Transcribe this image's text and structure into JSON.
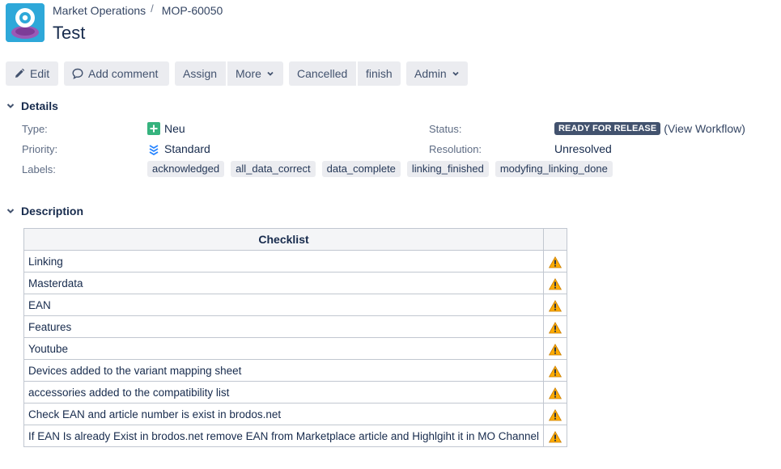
{
  "breadcrumb": {
    "project": "Market Operations",
    "issue_key": "MOP-60050",
    "separator": "/"
  },
  "issue": {
    "title": "Test"
  },
  "toolbar": {
    "edit": "Edit",
    "add_comment": "Add comment",
    "assign": "Assign",
    "more": "More",
    "cancelled": "Cancelled",
    "finish": "finish",
    "admin": "Admin"
  },
  "details": {
    "heading": "Details",
    "type_label": "Type:",
    "type_value": "Neu",
    "priority_label": "Priority:",
    "priority_value": "Standard",
    "labels_label": "Labels:",
    "labels": [
      "acknowledged",
      "all_data_correct",
      "data_complete",
      "linking_finished",
      "modyfing_linking_done"
    ],
    "status_label": "Status:",
    "status_value": "READY FOR RELEASE",
    "view_workflow": "(View Workflow)",
    "resolution_label": "Resolution:",
    "resolution_value": "Unresolved"
  },
  "description": {
    "heading": "Description",
    "table_header": "Checklist",
    "rows": [
      "Linking",
      "Masterdata",
      "EAN",
      "Features",
      "Youtube",
      "Devices added to the variant mapping sheet",
      "accessories added to the compatibility list",
      "Check EAN and article number is exist in brodos.net",
      "If EAN Is already Exist in brodos.net remove EAN from Marketplace article and Highlgiht it in MO Channel"
    ]
  },
  "colors": {
    "status": "#42526e",
    "type_icon": "#36b37e",
    "priority_icon": "#2684ff",
    "warning": "#ffab00",
    "avatar": "#2ea8d9"
  }
}
